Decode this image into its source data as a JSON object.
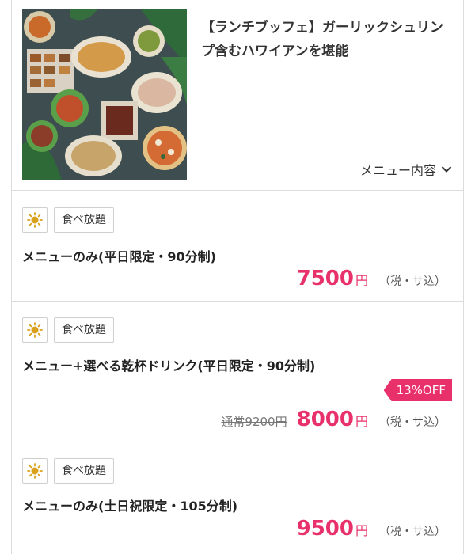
{
  "header": {
    "title": "【ランチブッフェ】ガーリックシュリンプ含むハワイアンを堪能",
    "menu_toggle_label": "メニュー内容"
  },
  "plans": [
    {
      "badge": "食べ放題",
      "name": "メニューのみ(平日限定・90分制)",
      "price": "7500",
      "currency": "円",
      "tax_note": "（税・サ込）"
    },
    {
      "badge": "食べ放題",
      "name": "メニュー+選べる乾杯ドリンク(平日限定・90分制)",
      "discount": "13%OFF",
      "regular_price": "通常9200円",
      "price": "8000",
      "currency": "円",
      "tax_note": "（税・サ込）"
    },
    {
      "badge": "食べ放題",
      "name": "メニューのみ(土日祝限定・105分制)",
      "price": "9500",
      "currency": "円",
      "tax_note": "（税・サ込）"
    }
  ],
  "colors": {
    "accent": "#e8316a",
    "sun_icon": "#d9a11b",
    "border": "#dcdcdc"
  },
  "icons": [
    "sun-icon",
    "chevron-down-icon"
  ]
}
